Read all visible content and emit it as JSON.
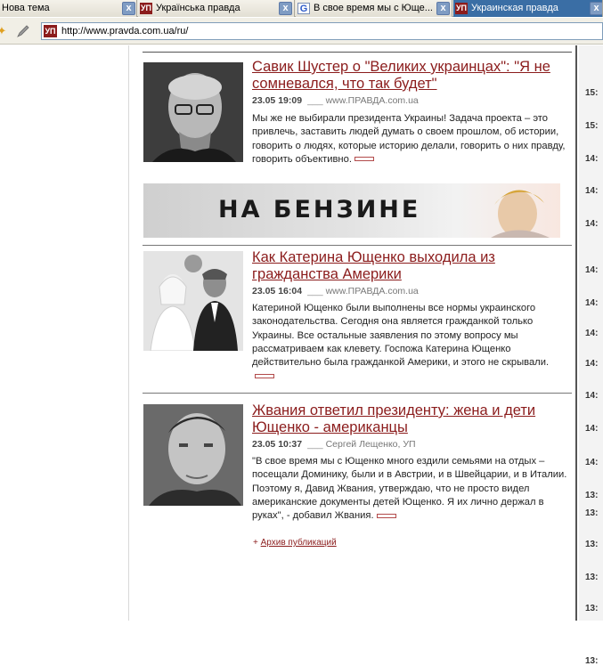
{
  "tabs": [
    {
      "label": "Нова тема",
      "favicon": "",
      "active": false
    },
    {
      "label": "Українська правда",
      "favicon": "УП",
      "active": false
    },
    {
      "label": "В свое время мы с Юще...",
      "favicon": "G",
      "active": false
    },
    {
      "label": "Украинская правда",
      "favicon": "УП",
      "active": true
    }
  ],
  "tab_close_glyph": "x",
  "address": {
    "url": "http://www.pravda.com.ua/ru/",
    "favicon": "УП"
  },
  "right_column": {
    "times": [
      "15:",
      "15:",
      "14:",
      "14:",
      "14:",
      "14:",
      "14:",
      "14:",
      "14:",
      "14:",
      "14:",
      "14:",
      "13:",
      "13:",
      "13:",
      "13:",
      "13:",
      "13:"
    ]
  },
  "articles": [
    {
      "title": "Савик Шустер о \"Великих украинцах\": \"Я не сомневался, что так будет\"",
      "date": "23.05 19:09",
      "source": "www.ПРАВДА.com.ua",
      "summary": "Мы же не выбирали президента Украины! Задача проекта – это привлечь, заставить людей думать о своем прошлом, об истории, говорить о людях, которые историю делали, говорить о них правду, говорить объективно.",
      "photo_icon": "portrait-photo"
    },
    {
      "title": "Как Катерина Ющенко выходила из гражданства Америки",
      "date": "23.05 16:04",
      "source": "www.ПРАВДА.com.ua",
      "summary": "Катериной Ющенко были выполнены все нормы украинского законодательства. Сегодня она является гражданкой только Украины. Все остальные заявления по этому вопросу мы рассматриваем как клевету. Госпожа Катерина Ющенко действительно была гражданкой Америки, и этого не скрывали.",
      "photo_icon": "couple-photo"
    },
    {
      "title": "Жвания ответил президенту: жена и дети Ющенко - американцы",
      "date": "23.05 10:37",
      "source": "Сергей Лещенко, УП",
      "summary": "\"В свое время мы с Ющенко много ездили семьями на отдых – посещали Доминику, были и в Австрии, и в Швейцарии, и в Италии. Поэтому я, Давид Жвания, утверждаю, что не просто видел американские документы детей Ющенко. Я их лично держал в руках\", - добавил Жвания.",
      "photo_icon": "portrait-photo"
    }
  ],
  "banner": {
    "text": "НА БЕНЗИНЕ"
  },
  "archive": {
    "prefix": "+",
    "label": "Архив публикаций"
  },
  "colors": {
    "link": "#8b1c1c",
    "active_tab": "#3a6ea5"
  }
}
